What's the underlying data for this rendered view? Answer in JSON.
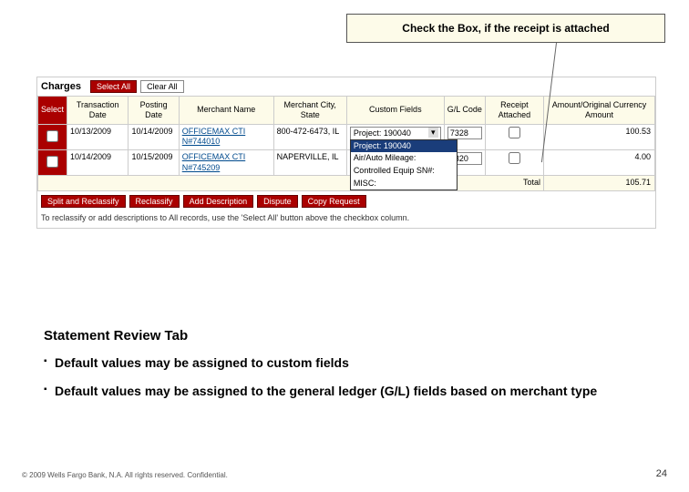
{
  "callout": {
    "text": "Check the Box, if the receipt is attached"
  },
  "panel": {
    "title": "Charges",
    "select_all": "Select All",
    "clear_all": "Clear All"
  },
  "columns": {
    "select": "Select",
    "trans_date": "Transaction Date",
    "post_date": "Posting Date",
    "merchant_name": "Merchant Name",
    "merchant_city": "Merchant City, State",
    "custom_fields": "Custom Fields",
    "gl_code": "G/L Code",
    "receipt": "Receipt Attached",
    "amount": "Amount/Original Currency Amount"
  },
  "rows": [
    {
      "trans_date": "10/13/2009",
      "post_date": "10/14/2009",
      "merchant": "OFFICEMAX CTI N#744010",
      "city": "800-472-6473, IL",
      "custom_selected": "Project: 190040",
      "gl": "7328",
      "amount": "100.53"
    },
    {
      "trans_date": "10/14/2009",
      "post_date": "10/15/2009",
      "merchant": "OFFICEMAX CTI N#745209",
      "city": "NAPERVILLE, IL",
      "custom_selected": "",
      "gl": "7320",
      "amount": "4.00"
    }
  ],
  "dropdown": {
    "options": [
      "Project: 190040",
      "Air/Auto Mileage:",
      "Controlled Equip SN#:",
      "MISC:"
    ]
  },
  "total": {
    "label": "Total",
    "value": "105.71"
  },
  "actions": {
    "split": "Split and Reclassify",
    "reclassify": "Reclassify",
    "add_desc": "Add Description",
    "dispute": "Dispute",
    "copy": "Copy Request"
  },
  "hint": "To reclassify or add descriptions to All records, use the 'Select All' button above the checkbox column.",
  "slide": {
    "heading": "Statement Review Tab",
    "bullet1": "Default values may be assigned to custom fields",
    "bullet2": "Default values may be assigned to the general ledger (G/L) fields based on merchant type"
  },
  "footer": "© 2009 Wells Fargo Bank, N.A. All rights reserved. Confidential.",
  "page": "24"
}
